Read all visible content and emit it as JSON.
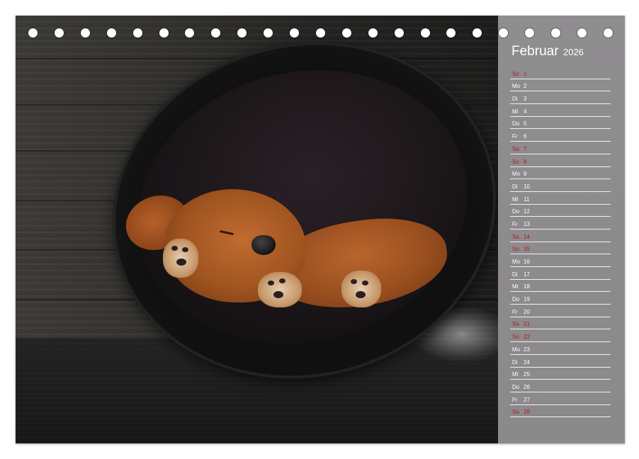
{
  "calendar": {
    "month": "Februar",
    "year": "2026",
    "days": [
      {
        "wd": "So",
        "n": "1",
        "weekend": true
      },
      {
        "wd": "Mo",
        "n": "2",
        "weekend": false
      },
      {
        "wd": "Di",
        "n": "3",
        "weekend": false
      },
      {
        "wd": "Mi",
        "n": "4",
        "weekend": false
      },
      {
        "wd": "Do",
        "n": "5",
        "weekend": false
      },
      {
        "wd": "Fr",
        "n": "6",
        "weekend": false
      },
      {
        "wd": "Sa",
        "n": "7",
        "weekend": true
      },
      {
        "wd": "So",
        "n": "8",
        "weekend": true
      },
      {
        "wd": "Mo",
        "n": "9",
        "weekend": false
      },
      {
        "wd": "Di",
        "n": "10",
        "weekend": false
      },
      {
        "wd": "Mi",
        "n": "11",
        "weekend": false
      },
      {
        "wd": "Do",
        "n": "12",
        "weekend": false
      },
      {
        "wd": "Fr",
        "n": "13",
        "weekend": false
      },
      {
        "wd": "Sa",
        "n": "14",
        "weekend": true
      },
      {
        "wd": "So",
        "n": "15",
        "weekend": true
      },
      {
        "wd": "Mo",
        "n": "16",
        "weekend": false
      },
      {
        "wd": "Di",
        "n": "17",
        "weekend": false
      },
      {
        "wd": "Mi",
        "n": "18",
        "weekend": false
      },
      {
        "wd": "Do",
        "n": "19",
        "weekend": false
      },
      {
        "wd": "Fr",
        "n": "20",
        "weekend": false
      },
      {
        "wd": "Sa",
        "n": "21",
        "weekend": true
      },
      {
        "wd": "So",
        "n": "22",
        "weekend": true
      },
      {
        "wd": "Mo",
        "n": "23",
        "weekend": false
      },
      {
        "wd": "Di",
        "n": "24",
        "weekend": false
      },
      {
        "wd": "Mi",
        "n": "25",
        "weekend": false
      },
      {
        "wd": "Do",
        "n": "26",
        "weekend": false
      },
      {
        "wd": "Fr",
        "n": "27",
        "weekend": false
      },
      {
        "wd": "Sa",
        "n": "28",
        "weekend": true
      }
    ]
  },
  "colors": {
    "panel": "#8d8b8d",
    "weekend": "#b51a1a",
    "weekday": "#ffffff"
  },
  "binding": {
    "ring_count": 23
  }
}
